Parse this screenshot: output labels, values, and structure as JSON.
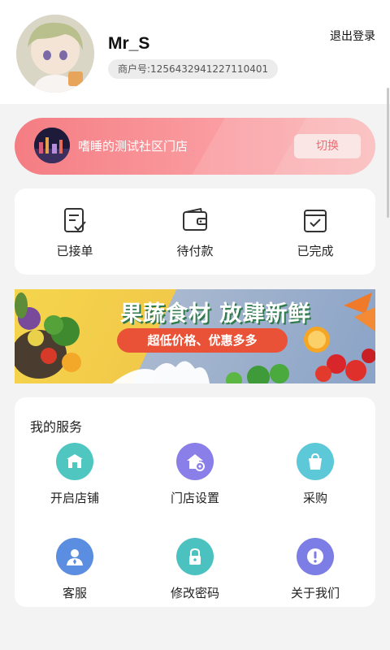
{
  "profile": {
    "username": "Mr_S",
    "merchant_id": "商户号:1256432941227110401",
    "logout_label": "退出登录"
  },
  "store": {
    "name": "嗜睡的测试社区门店",
    "switch_label": "切换",
    "colors": {
      "banner_start": "#f47d83",
      "banner_end": "#fbb5b6",
      "button_text": "#ee6a72"
    }
  },
  "orders": {
    "items": [
      {
        "label": "已接单",
        "icon": "accepted-order-icon"
      },
      {
        "label": "待付款",
        "icon": "wallet-icon"
      },
      {
        "label": "已完成",
        "icon": "completed-check-icon"
      }
    ]
  },
  "promo": {
    "title": "果蔬食材 放肆新鲜",
    "subtitle": "超低价格、优惠多多"
  },
  "services": {
    "heading": "我的服务",
    "items": [
      {
        "label": "开启店铺",
        "icon": "storefront-icon",
        "color": "#4fc7c0"
      },
      {
        "label": "门店设置",
        "icon": "store-settings-icon",
        "color": "#8a7ee8"
      },
      {
        "label": "采购",
        "icon": "shopping-bag-icon",
        "color": "#5cc8d8"
      },
      {
        "label": "客服",
        "icon": "customer-service-icon",
        "color": "#5b8de0"
      },
      {
        "label": "修改密码",
        "icon": "lock-icon",
        "color": "#4cc2c0"
      },
      {
        "label": "关于我们",
        "icon": "info-icon",
        "color": "#7d7de6"
      }
    ]
  }
}
